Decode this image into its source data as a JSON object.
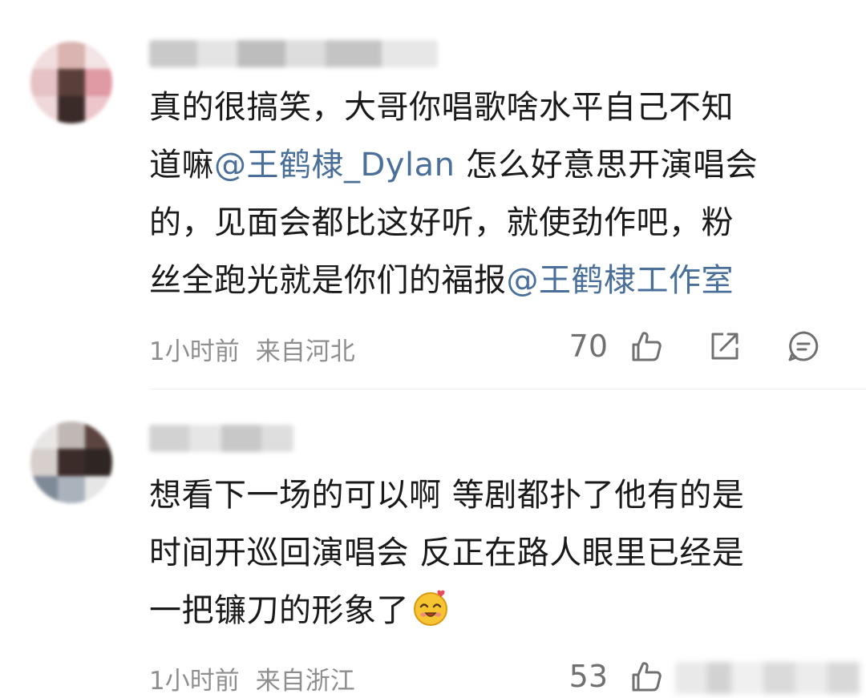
{
  "comments": [
    {
      "text_lines": [
        [
          {
            "t": "真的很搞笑，大哥你唱歌啥水平自己不知"
          }
        ],
        [
          {
            "t": "道嘛"
          },
          {
            "t": "@王鹤棣_Dylan",
            "mention": true
          },
          {
            "t": " 怎么好意思开演唱会"
          }
        ],
        [
          {
            "t": "的，见面会都比这好听，就使劲作吧，粉"
          }
        ],
        [
          {
            "t": "丝全跑光就是你们的福报"
          },
          {
            "t": "@王鹤棣工作室",
            "mention": true
          }
        ]
      ],
      "time": "1小时前",
      "location": "来自河北",
      "likes": "70",
      "icons": [
        "thumbs-up-icon",
        "share-icon",
        "comment-icon"
      ]
    },
    {
      "text_lines": [
        [
          {
            "t": "想看下一场的可以啊 等剧都扑了他有的是"
          }
        ],
        [
          {
            "t": "时间开巡回演唱会 反正在路人眼里已经是"
          }
        ],
        [
          {
            "t": "一把镰刀的形象了"
          }
        ]
      ],
      "time": "1小时前",
      "location": "来自浙江",
      "likes": "53",
      "icons": [
        "thumbs-up-icon"
      ]
    }
  ],
  "colors": {
    "mention": "#4a6f99",
    "meta": "#8e8e8e",
    "text": "#1a1a1a"
  }
}
